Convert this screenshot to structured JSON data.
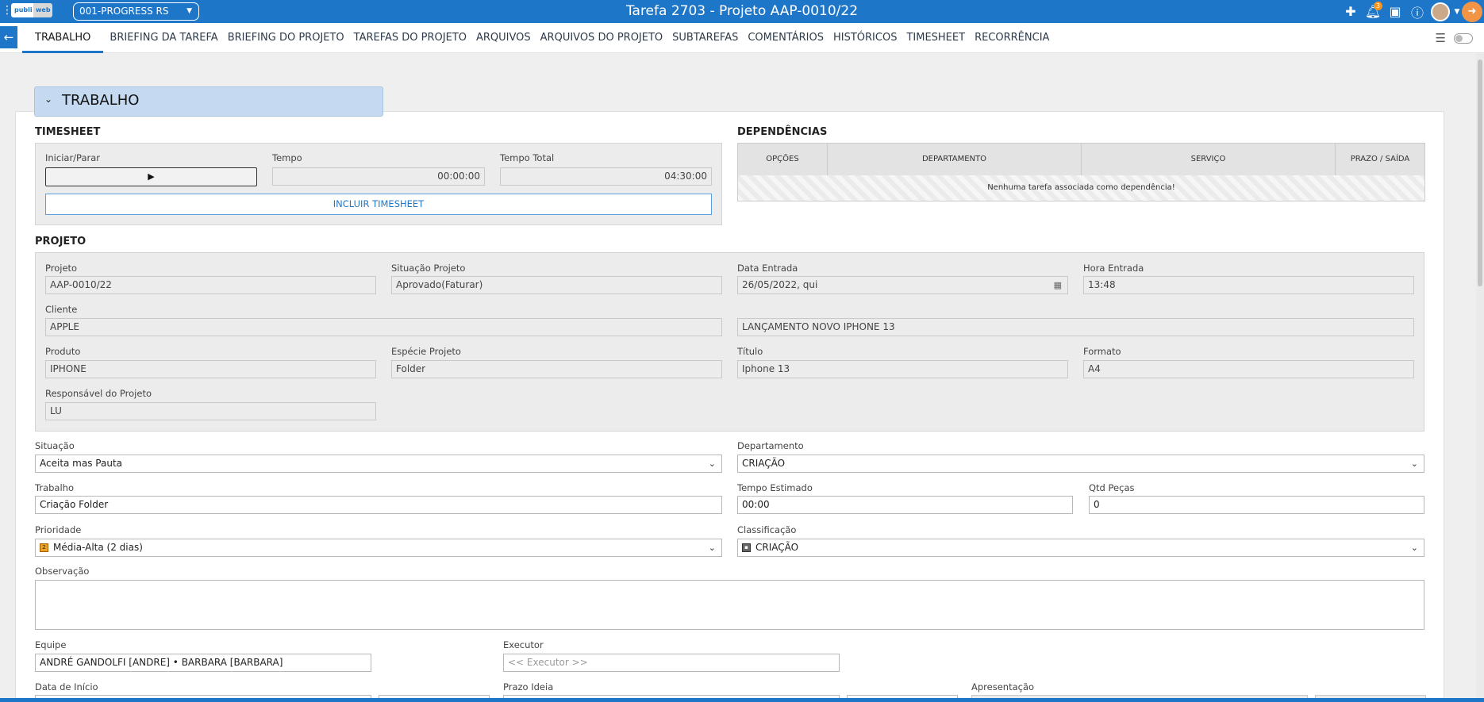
{
  "topbar": {
    "logo_a": "publi",
    "logo_b": "web",
    "company": "001-PROGRESS RS",
    "title": "Tarefa 2703 - Projeto AAP-0010/22",
    "notif_count": "3"
  },
  "tabs": [
    "TRABALHO",
    "BRIEFING DA TAREFA",
    "BRIEFING DO PROJETO",
    "TAREFAS DO PROJETO",
    "ARQUIVOS",
    "ARQUIVOS DO PROJETO",
    "SUBTAREFAS",
    "COMENTÁRIOS",
    "HISTÓRICOS",
    "TIMESHEET",
    "RECORRÊNCIA"
  ],
  "section_title": "TRABALHO",
  "timesheet": {
    "heading": "TIMESHEET",
    "start_label": "Iniciar/Parar",
    "time_label": "Tempo",
    "time_value": "00:00:00",
    "total_label": "Tempo Total",
    "total_value": "04:30:00",
    "add_button": "INCLUIR TIMESHEET"
  },
  "dependencias": {
    "heading": "DEPENDÊNCIAS",
    "columns": [
      "OPÇÕES",
      "DEPARTAMENTO",
      "SERVIÇO",
      "PRAZO / SAÍDA"
    ],
    "empty": "Nenhuma tarefa associada como dependência!"
  },
  "projeto": {
    "heading": "PROJETO",
    "projeto_label": "Projeto",
    "projeto": "AAP-0010/22",
    "situacao_label": "Situação Projeto",
    "situacao": "Aprovado(Faturar)",
    "data_label": "Data Entrada",
    "data": "26/05/2022, qui",
    "hora_label": "Hora Entrada",
    "hora": "13:48",
    "cliente_label": "Cliente",
    "cliente": "APPLE",
    "descricao": "LANÇAMENTO NOVO IPHONE 13",
    "produto_label": "Produto",
    "produto": "IPHONE",
    "especie_label": "Espécie Projeto",
    "especie": "Folder",
    "titulo_label": "Título",
    "titulo": "Iphone 13",
    "formato_label": "Formato",
    "formato": "A4",
    "responsavel_label": "Responsável do Projeto",
    "responsavel": "LU"
  },
  "form": {
    "situacao_label": "Situação",
    "situacao": "Aceita mas Pauta",
    "departamento_label": "Departamento",
    "departamento": "CRIAÇÃO",
    "trabalho_label": "Trabalho",
    "trabalho": "Criação Folder",
    "tempo_label": "Tempo Estimado",
    "tempo": "00:00",
    "qtd_label": "Qtd Peças",
    "qtd": "0",
    "prioridade_label": "Prioridade",
    "prioridade": "Média-Alta (2 dias)",
    "classificacao_label": "Classificação",
    "classificacao": "CRIAÇÃO",
    "observacao_label": "Observação",
    "equipe_label": "Equipe",
    "equipe": "ANDRÉ GANDOLFI [ANDRE] • BARBARA [BARBARA]",
    "executor_label": "Executor",
    "executor_placeholder": "<< Executor >>",
    "inicio_label": "Data de Início",
    "prazo_label": "Prazo Ideia",
    "apresentacao_label": "Apresentação"
  }
}
